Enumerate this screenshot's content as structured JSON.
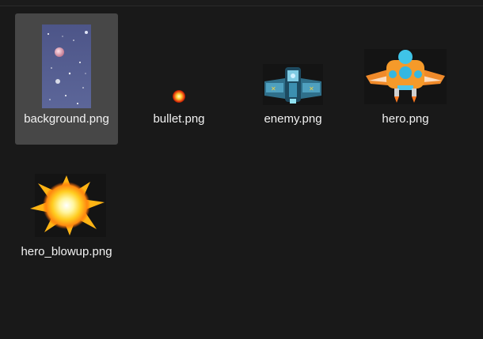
{
  "files": [
    {
      "name": "background.png",
      "selected": true
    },
    {
      "name": "bullet.png",
      "selected": false
    },
    {
      "name": "enemy.png",
      "selected": false
    },
    {
      "name": "hero.png",
      "selected": false
    },
    {
      "name": "hero_blowup.png",
      "selected": false
    }
  ],
  "colors": {
    "window_bg": "#191919",
    "selection_bg": "#474747",
    "text": "#f2f2f2"
  },
  "icons": [
    "background-thumbnail-icon",
    "bullet-thumbnail-icon",
    "enemy-thumbnail-icon",
    "hero-thumbnail-icon",
    "hero-blowup-thumbnail-icon"
  ]
}
